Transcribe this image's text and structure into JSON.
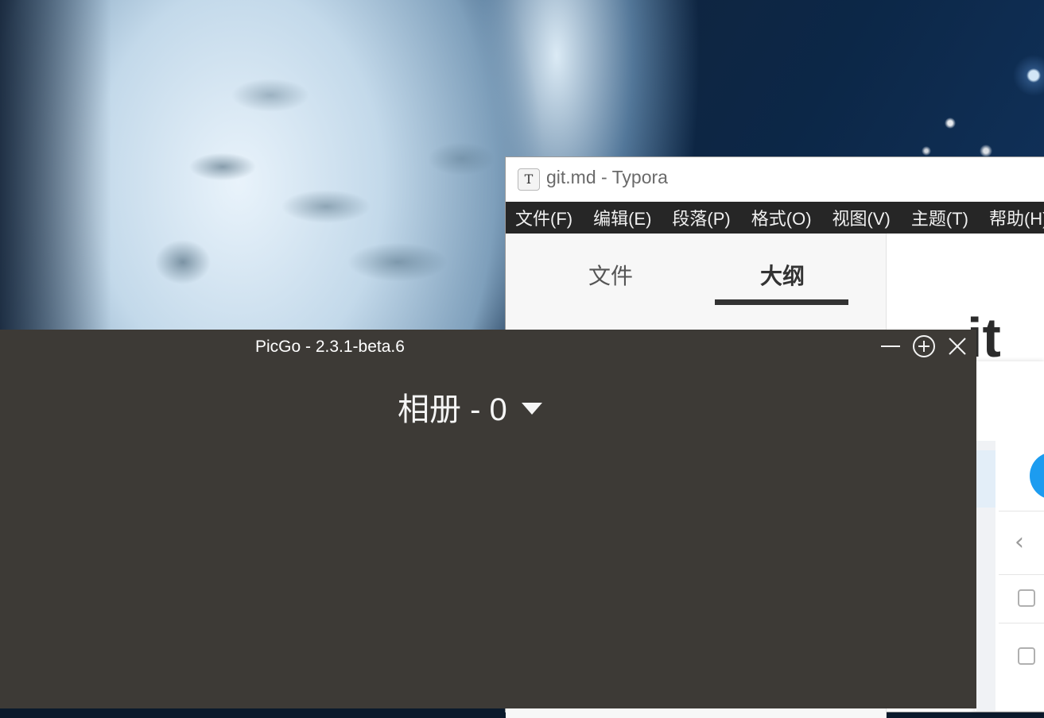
{
  "typora": {
    "icon_letter": "T",
    "title": "git.md - Typora",
    "menu": [
      "文件(F)",
      "编辑(E)",
      "段落(P)",
      "格式(O)",
      "视图(V)",
      "主题(T)",
      "帮助(H)"
    ],
    "sidebar_tabs": {
      "files": "文件",
      "outline": "大纲"
    },
    "active_tab": "outline",
    "heading_fragment": "it"
  },
  "picgo": {
    "title": "PicGo - 2.3.1-beta.6",
    "gallery_title": "相册 - 0",
    "background_color": "#3d3a36"
  },
  "colors": {
    "typora_menubar": "#262626",
    "accent_blue": "#1c9cf0"
  }
}
